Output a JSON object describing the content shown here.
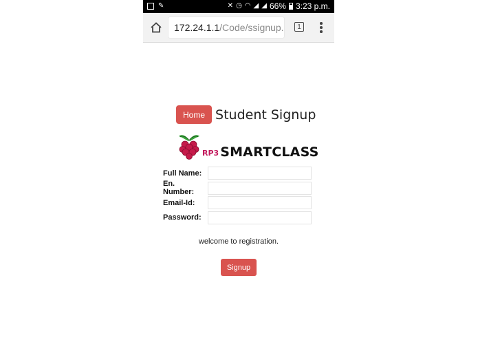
{
  "status_bar": {
    "battery": "66%",
    "time": "3:23 p.m."
  },
  "browser": {
    "url_host": "172.24.1.1",
    "url_path": "/Code/ssignup.p",
    "tab_count": "1"
  },
  "page": {
    "home_button": "Home",
    "title": "Student Signup",
    "logo": {
      "badge": "RP3",
      "name": "SMARTCLASS"
    },
    "form": {
      "fields": [
        {
          "label": "Full Name:",
          "value": ""
        },
        {
          "label": "En. Number:",
          "value": ""
        },
        {
          "label": "Email-Id:",
          "value": ""
        },
        {
          "label": "Password:",
          "value": ""
        }
      ]
    },
    "message": "welcome to registration.",
    "signup_button": "Signup"
  },
  "colors": {
    "button": "#d9534f",
    "status_bar": "#000000",
    "logo_badge": "#c2185b"
  }
}
